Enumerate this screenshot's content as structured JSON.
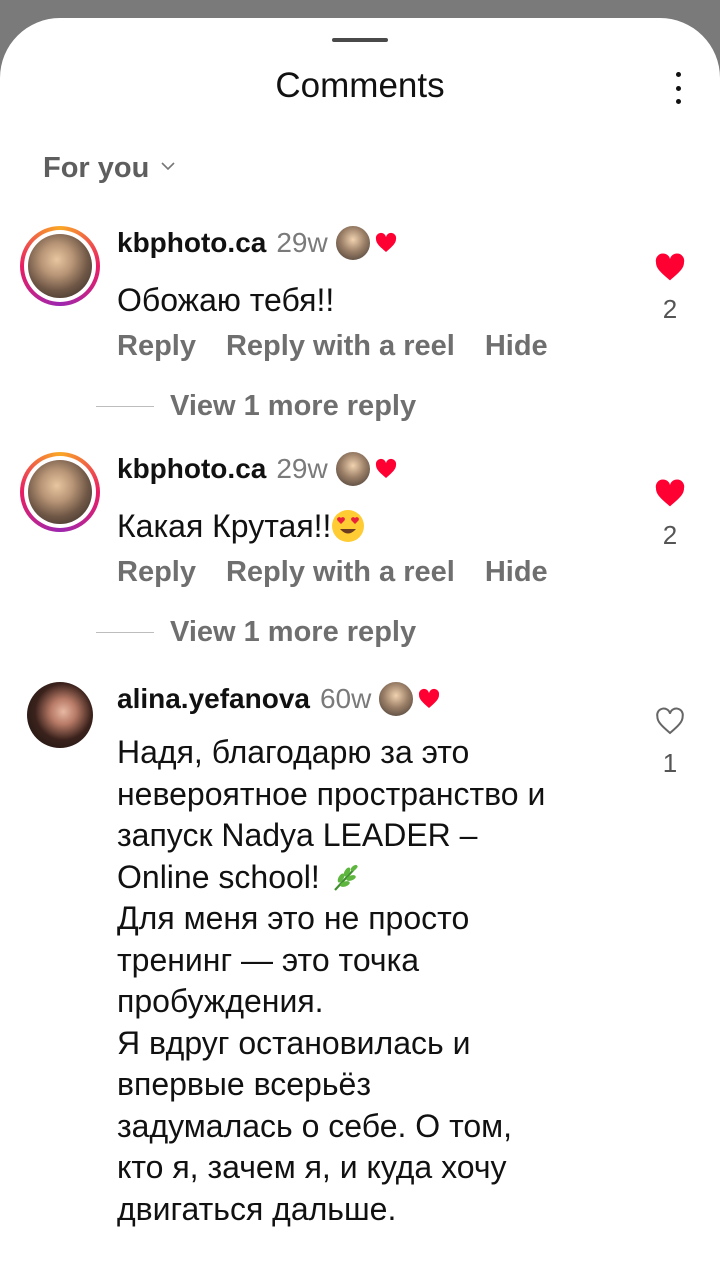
{
  "header": {
    "title": "Comments"
  },
  "filter": {
    "label": "For you"
  },
  "comments": [
    {
      "username": "kbphoto.ca",
      "time": "29w",
      "text": "Обожаю тебя!!",
      "likes": "2",
      "liked": true,
      "actions": [
        "Reply",
        "Reply with a reel",
        "Hide"
      ],
      "view_more": "View 1 more reply"
    },
    {
      "username": "kbphoto.ca",
      "time": "29w",
      "text": "Какая Крутая!!",
      "likes": "2",
      "liked": true,
      "actions": [
        "Reply",
        "Reply with a reel",
        "Hide"
      ],
      "view_more": "View 1 more reply"
    },
    {
      "username": "alina.yefanova",
      "time": "60w",
      "text_lines": [
        "Надя, благодарю за это",
        "невероятное пространство и",
        "запуск Nadya LEADER –",
        "Online school!",
        "Для меня это не просто",
        "тренинг — это точка",
        "пробуждения.",
        "Я вдруг остановилась и",
        "впервые всерьёз",
        "задумалась о себе. О том,",
        "кто я, зачем я, и куда хочу",
        "двигаться дальше."
      ],
      "likes": "1",
      "liked": false
    }
  ],
  "colors": {
    "heart_red": "#ff0033",
    "muted_text": "#6f6f6f"
  },
  "icons": [
    "more-vertical-icon",
    "chevron-down-icon",
    "heart-filled-icon",
    "heart-outline-icon",
    "heart-eyes-emoji",
    "herb-emoji"
  ]
}
